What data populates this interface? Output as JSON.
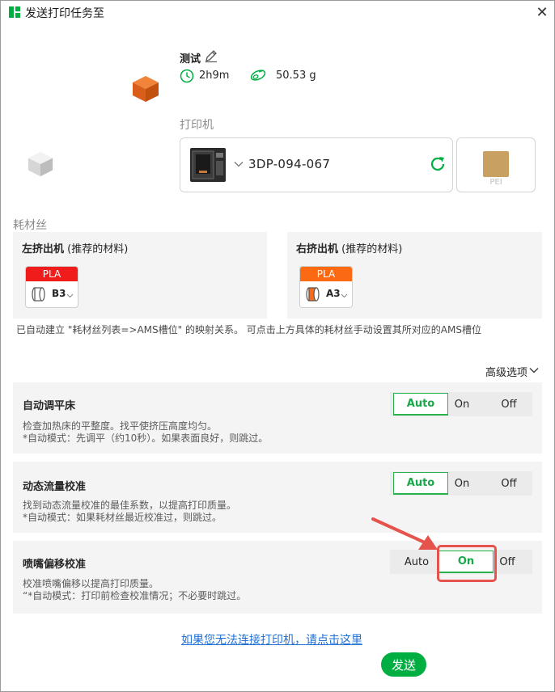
{
  "window": {
    "title": "发送打印任务至",
    "close_glyph": "✕"
  },
  "model": {
    "name": "测试",
    "print_time": "2h9m",
    "weight": "50.53 g",
    "cube1_color": "#e8651e",
    "cube2_color": "#d9d9d9"
  },
  "printer": {
    "section_label": "打印机",
    "name": "3DP-094-067",
    "plate_label": "PEI",
    "accent": "#00ae42"
  },
  "filament": {
    "section_label": "耗材丝",
    "left": {
      "title": "左挤出机",
      "subtitle": "(推荐的材料)",
      "type": "PLA",
      "slot": "B3",
      "color": "#f01b1b"
    },
    "right": {
      "title": "右挤出机",
      "subtitle": "(推荐的材料)",
      "type": "PLA",
      "slot": "A3",
      "color": "#fb6a13"
    },
    "mapping_note": "已自动建立 \"耗材丝列表=>AMS槽位\" 的映射关系。 可点击上方具体的耗材丝手动设置其所对应的AMS槽位"
  },
  "advanced": {
    "label": "高级选项"
  },
  "options": [
    {
      "title": "自动调平床",
      "desc": "检查加热床的平整度。找平使挤压高度均匀。\n*自动模式：先调平（约10秒）。如果表面良好，则跳过。",
      "choices": [
        "Auto",
        "On",
        "Off"
      ],
      "selected": "Auto"
    },
    {
      "title": "动态流量校准",
      "desc": "找到动态流量校准的最佳系数，以提高打印质量。\n*自动模式：如果耗材丝最近校准过，则跳过。",
      "choices": [
        "Auto",
        "On",
        "Off"
      ],
      "selected": "Auto"
    },
    {
      "title": "喷嘴偏移校准",
      "desc": "校准喷嘴偏移以提高打印质量。\n“*自动模式：打印前检查校准情况；不必要时跳过。",
      "choices": [
        "Auto",
        "On",
        "Off"
      ],
      "selected": "On"
    }
  ],
  "footer": {
    "help_link": "如果您无法连接打印机，请点击这里",
    "send_label": "发送"
  },
  "colors": {
    "accent": "#00ae42",
    "annotation": "#e6524c",
    "link": "#1e6fd6"
  }
}
